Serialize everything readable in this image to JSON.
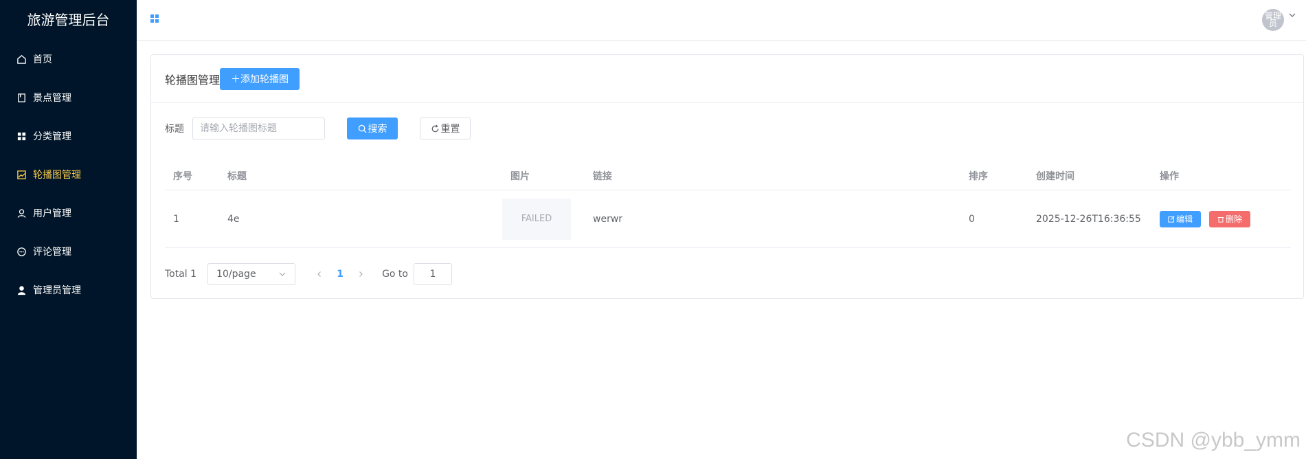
{
  "app": {
    "title": "旅游管理后台"
  },
  "sidebar": {
    "items": [
      {
        "label": "首页",
        "icon": "house-icon"
      },
      {
        "label": "景点管理",
        "icon": "notebook-icon"
      },
      {
        "label": "分类管理",
        "icon": "grid-icon"
      },
      {
        "label": "轮播图管理",
        "icon": "picture-icon",
        "active": true
      },
      {
        "label": "用户管理",
        "icon": "user-icon"
      },
      {
        "label": "评论管理",
        "icon": "chat-icon"
      },
      {
        "label": "管理员管理",
        "icon": "user-filled-icon"
      }
    ]
  },
  "header": {
    "avatar_text": "管理员"
  },
  "page": {
    "title": "轮播图管理",
    "add_button": "＋添加轮播图"
  },
  "search": {
    "label": "标题",
    "placeholder": "请输入轮播图标题",
    "search_button": "搜索",
    "reset_button": "重置"
  },
  "table": {
    "headers": [
      "序号",
      "标题",
      "图片",
      "链接",
      "排序",
      "创建时间",
      "操作"
    ],
    "rows": [
      {
        "index": "1",
        "title": "4e",
        "image": "FAILED",
        "link": "werwr",
        "sort": "0",
        "created": "2025-12-26T16:36:55",
        "edit": "编辑",
        "delete": "删除"
      }
    ]
  },
  "pagination": {
    "total": "Total 1",
    "page_size": "10/page",
    "current_page": "1",
    "goto_label": "Go to",
    "goto_value": "1"
  },
  "watermark": "CSDN @ybb_ymm",
  "colors": {
    "sidebar_bg": "#001529",
    "active": "#ffd04b",
    "primary": "#409eff",
    "danger": "#f56c6c"
  }
}
